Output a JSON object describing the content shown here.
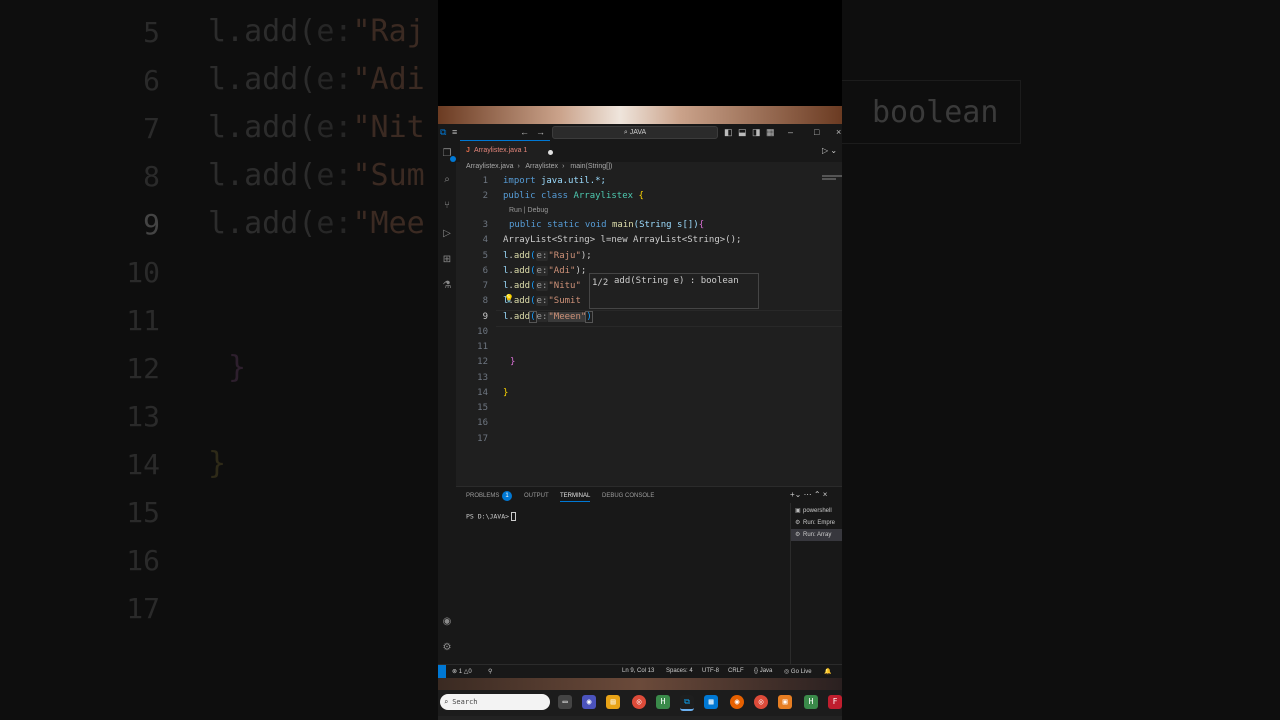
{
  "background": {
    "left_lines": [
      {
        "num": "5",
        "method": "l.add(",
        "hint": "e:",
        "str": "\"Raj"
      },
      {
        "num": "6",
        "method": "l.add(",
        "hint": "e:",
        "str": "\"Adi"
      },
      {
        "num": "7",
        "method": "l.add(",
        "hint": "e:",
        "str": "\"Nit"
      },
      {
        "num": "8",
        "method": "l.add(",
        "hint": "e:",
        "str": "\"Sum"
      },
      {
        "num": "9",
        "method": "l.add(",
        "hint": "e:",
        "str": "\"Mee"
      },
      {
        "num": "10",
        "method": "",
        "hint": "",
        "str": ""
      },
      {
        "num": "11",
        "method": "",
        "hint": "",
        "str": ""
      },
      {
        "num": "12",
        "method": "}",
        "hint": "",
        "str": ""
      },
      {
        "num": "13",
        "method": "",
        "hint": "",
        "str": ""
      },
      {
        "num": "14",
        "method": "}",
        "hint": "",
        "str": ""
      },
      {
        "num": "15",
        "method": "",
        "hint": "",
        "str": ""
      },
      {
        "num": "16",
        "method": "",
        "hint": "",
        "str": ""
      },
      {
        "num": "17",
        "method": "",
        "hint": "",
        "str": ""
      }
    ],
    "right_text": "boolean"
  },
  "titlebar": {
    "search": "JAVA"
  },
  "tab": {
    "icon": "J",
    "label": "Arraylistex.java 1"
  },
  "breadcrumb": {
    "file": "Arraylistex.java",
    "class": "Arraylistex",
    "method": "main(String[])"
  },
  "editor": {
    "codelens": "Run | Debug",
    "line_numbers": [
      "1",
      "2",
      "3",
      "4",
      "5",
      "6",
      "7",
      "8",
      "9",
      "10",
      "11",
      "12",
      "13",
      "14",
      "15",
      "16",
      "17"
    ],
    "line1": {
      "kw": "import",
      "rest": "java.util.*;"
    },
    "line2": {
      "kw1": "public",
      "kw2": "class",
      "name": "Arraylistex",
      "brace": "{"
    },
    "line3": {
      "kw1": "public",
      "kw2": "static",
      "kw3": "void",
      "fn": "main",
      "params": "(String s[])",
      "brace": "{"
    },
    "line4": "ArrayList<String> l=new ArrayList<String>();",
    "adds": [
      {
        "obj": "l",
        "fn": "add",
        "hint": "e:",
        "str": "\"Raju\"",
        "end": ");"
      },
      {
        "obj": "l",
        "fn": "add",
        "hint": "e:",
        "str": "\"Adi\"",
        "end": ");"
      },
      {
        "obj": "l",
        "fn": "add",
        "hint": "e:",
        "str": "\"Nitu\"",
        "end": ""
      },
      {
        "obj": "l",
        "fn": "add",
        "hint": "e:",
        "str": "\"Sumit",
        "end": ""
      },
      {
        "obj": "l",
        "fn": "add",
        "hint": "e:",
        "str": "\"Meeen\"",
        "end": ")"
      }
    ],
    "line12": "}",
    "line14": "}"
  },
  "signature_help": {
    "count": "1/2",
    "signature": "add(String e) : boolean"
  },
  "panel": {
    "tabs": [
      "PROBLEMS",
      "OUTPUT",
      "TERMINAL",
      "DEBUG CONSOLE"
    ],
    "problems_count": "1",
    "active_tab": "TERMINAL",
    "prompt": "PS D:\\JAVA>",
    "terminals": [
      {
        "label": "powershell",
        "selected": false
      },
      {
        "label": "Run: Empre",
        "selected": false
      },
      {
        "label": "Run: Array",
        "selected": true
      }
    ]
  },
  "statusbar": {
    "errors": "1",
    "warnings": "0",
    "position": "Ln 9, Col 13",
    "spaces": "Spaces: 4",
    "encoding": "UTF-8",
    "eol": "CRLF",
    "language": "Java",
    "golive": "Go Live"
  },
  "taskbar": {
    "search_placeholder": "Search"
  },
  "colors": {
    "accent": "#0078d4",
    "keyword": "#569cd6",
    "string": "#ce9178",
    "function": "#dcdcaa",
    "type": "#4ec9b0"
  }
}
